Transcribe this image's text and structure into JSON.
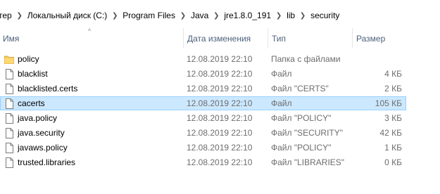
{
  "breadcrumb": {
    "items": [
      "тер",
      "Локальный диск (C:)",
      "Program Files",
      "Java",
      "jre1.8.0_191",
      "lib",
      "security"
    ]
  },
  "columns": {
    "name": "Имя",
    "date": "Дата изменения",
    "type": "Тип",
    "size": "Размер",
    "sort_indicator": "^"
  },
  "files": [
    {
      "name": "policy",
      "date": "12.08.2019 22:10",
      "type": "Папка с файлами",
      "size": "",
      "icon": "folder-icon"
    },
    {
      "name": "blacklist",
      "date": "12.08.2019 22:10",
      "type": "Файл",
      "size": "4 КБ",
      "icon": "file-icon"
    },
    {
      "name": "blacklisted.certs",
      "date": "12.08.2019 22:10",
      "type": "Файл \"CERTS\"",
      "size": "2 КБ",
      "icon": "file-icon"
    },
    {
      "name": "cacerts",
      "date": "12.08.2019 22:10",
      "type": "Файл",
      "size": "105 КБ",
      "icon": "file-icon",
      "selected": true
    },
    {
      "name": "java.policy",
      "date": "12.08.2019 22:10",
      "type": "Файл \"POLICY\"",
      "size": "3 КБ",
      "icon": "file-icon"
    },
    {
      "name": "java.security",
      "date": "12.08.2019 22:10",
      "type": "Файл \"SECURITY\"",
      "size": "42 КБ",
      "icon": "file-icon"
    },
    {
      "name": "javaws.policy",
      "date": "12.08.2019 22:10",
      "type": "Файл \"POLICY\"",
      "size": "1 КБ",
      "icon": "file-icon"
    },
    {
      "name": "trusted.libraries",
      "date": "12.08.2019 22:10",
      "type": "Файл \"LIBRARIES\"",
      "size": "0 КБ",
      "icon": "file-icon"
    }
  ],
  "colors": {
    "selection_fill": "#cce8ff",
    "selection_border": "#99d1ff",
    "header_text": "#4c607a",
    "folder": "#f4c95d"
  }
}
